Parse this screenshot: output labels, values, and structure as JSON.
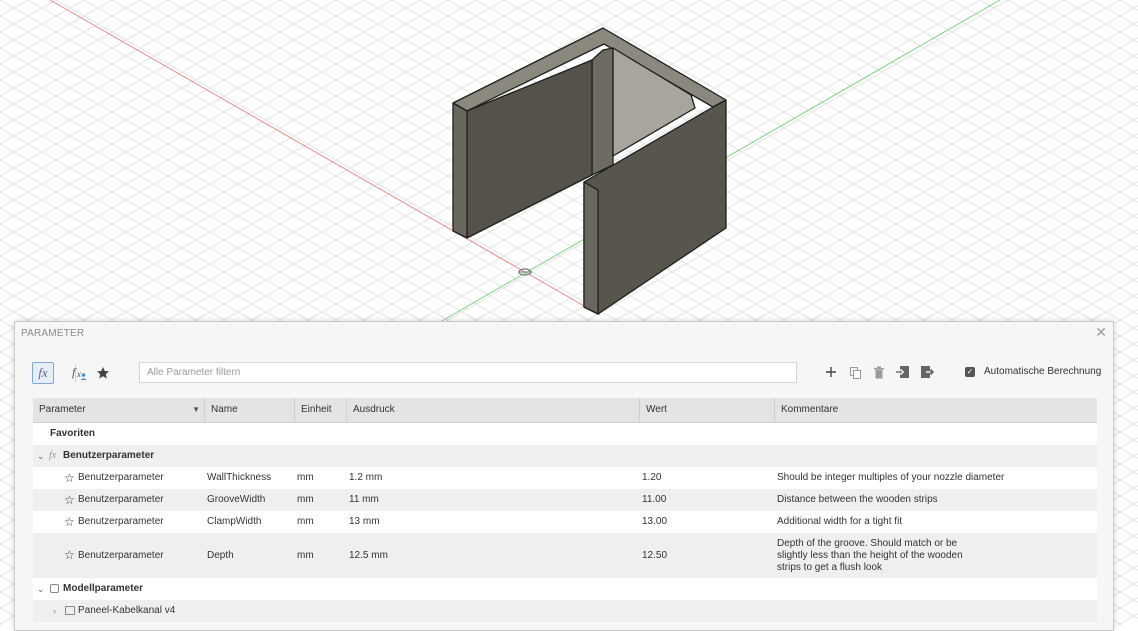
{
  "dialog": {
    "title": "PARAMETER",
    "close_glyph": "✕",
    "filter_placeholder": "Alle Parameter filtern",
    "auto_calc_label": "Automatische Berechnung",
    "auto_calc_checked": true
  },
  "toolbar": {
    "fx_icon": "fx",
    "icons": [
      "fx-icon",
      "user-fx-icon",
      "star-icon",
      "add-icon",
      "copy-icon",
      "delete-icon",
      "import-icon",
      "export-icon"
    ]
  },
  "table": {
    "columns": [
      "Parameter",
      "Name",
      "Einheit",
      "Ausdruck",
      "Wert",
      "Kommentare"
    ],
    "favorites_label": "Favoriten",
    "user_group_label": "Benutzerparameter",
    "rows": [
      {
        "param": "Benutzerparameter",
        "name": "WallThickness",
        "unit": "mm",
        "expr": "1.2 mm",
        "value": "1.20",
        "comment": "Should be integer multiples of your nozzle diameter"
      },
      {
        "param": "Benutzerparameter",
        "name": "GrooveWidth",
        "unit": "mm",
        "expr": "11 mm",
        "value": "11.00",
        "comment": "Distance between the wooden strips"
      },
      {
        "param": "Benutzerparameter",
        "name": "ClampWidth",
        "unit": "mm",
        "expr": "13 mm",
        "value": "13.00",
        "comment": "Additional width for a tight fit"
      },
      {
        "param": "Benutzerparameter",
        "name": "Depth",
        "unit": "mm",
        "expr": "12.5 mm",
        "value": "12.50",
        "comment": "Depth of the groove. Should match or be slightly less than the height of the wooden strips to get a flush look"
      }
    ],
    "model_group_label": "Modellparameter",
    "model_child_label": "Paneel-Kabelkanal v4"
  },
  "colors": {
    "x_axis": "#e88a8a",
    "y_axis": "#7fd27f",
    "solid": "#58554c",
    "accent": "#7fa8d8"
  }
}
